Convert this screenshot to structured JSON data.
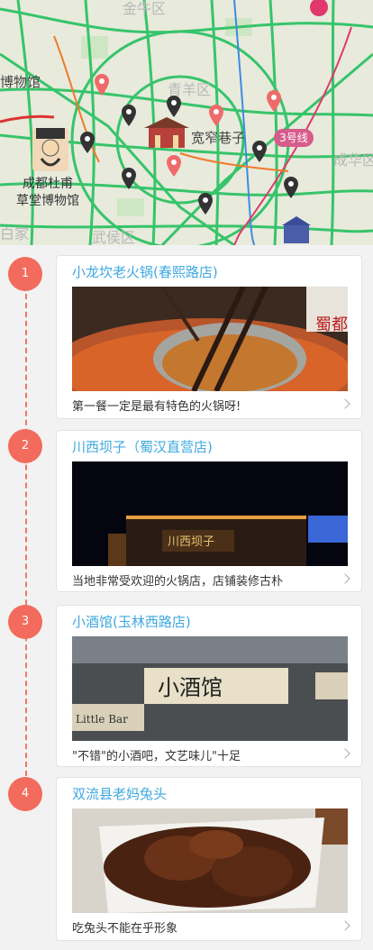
{
  "map": {
    "labels": {
      "museum_partial": "博物馆",
      "qingyang_district": "青羊区",
      "jinniu_district": "金牛区",
      "chenghua_district": "成华区",
      "wuhou_district": "武侯区",
      "baijia": "白家",
      "kuanzhai": "宽窄巷子",
      "dufu_line1": "成都杜甫",
      "dufu_line2": "草堂博物馆",
      "subway_line": "3号线"
    }
  },
  "items": [
    {
      "number": "1",
      "title": "小龙坎老火锅(春熙路店)",
      "description": "第一餐一定是最有特色的火锅呀!",
      "photo_sign": "蜀都"
    },
    {
      "number": "2",
      "title": "川西坝子（蜀汉直营店)",
      "description": "当地非常受欢迎的火锅店，店铺装修古朴",
      "photo_sign": "川西坝子"
    },
    {
      "number": "3",
      "title": "小酒馆(玉林西路店)",
      "description": "\"不错\"的小酒吧，文艺味儿\"十足",
      "photo_sign": "小酒馆",
      "photo_sign2": "Little Bar"
    },
    {
      "number": "4",
      "title": "双流县老妈兔头",
      "description": "吃兔头不能在乎形象"
    }
  ],
  "colors": {
    "accent": "#f26b5c",
    "title_blue": "#3fa8e0",
    "subway": "#d75c8c"
  }
}
